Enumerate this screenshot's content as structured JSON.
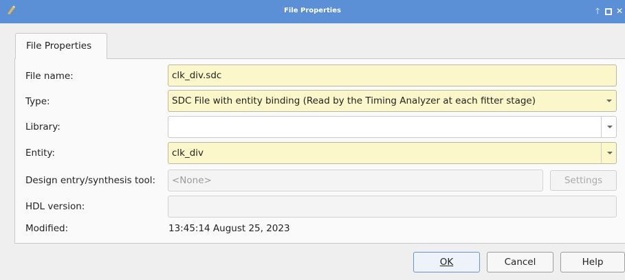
{
  "window": {
    "title": "File Properties",
    "controls": {
      "up": "🡑",
      "close": "✕"
    }
  },
  "tab": {
    "label": "File Properties"
  },
  "form": {
    "file_name": {
      "label": "File name:",
      "value": "clk_div.sdc"
    },
    "type": {
      "label": "Type:",
      "value": "SDC File with entity binding (Read by the Timing Analyzer at each fitter stage)"
    },
    "library": {
      "label": "Library:",
      "value": ""
    },
    "entity": {
      "label": "Entity:",
      "value": "clk_div"
    },
    "design_tool": {
      "label": "Design entry/synthesis tool:",
      "value": "<None>",
      "settings_label": "Settings"
    },
    "hdl_version": {
      "label": "HDL version:",
      "value": ""
    },
    "modified": {
      "label": "Modified:",
      "value": "13:45:14 August 25, 2023"
    }
  },
  "buttons": {
    "ok": "OK",
    "cancel": "Cancel",
    "help": "Help"
  },
  "colors": {
    "titlebar": "#5b8fd6",
    "required_field": "#fbf7ca"
  }
}
